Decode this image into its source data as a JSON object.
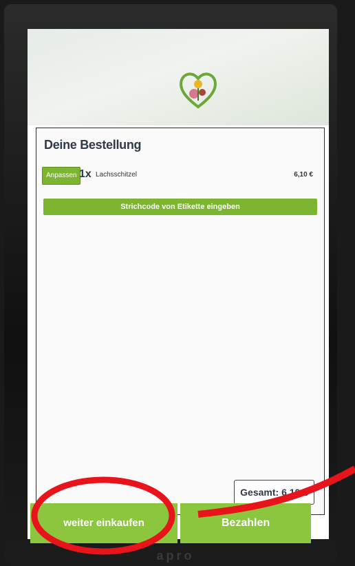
{
  "order": {
    "title": "Deine Bestellung",
    "items": [
      {
        "adjust_label": "Anpassen",
        "quantity": "1x",
        "name": "Lachsschitzel",
        "price": "6,10 €"
      }
    ],
    "barcode_label": "Strichcode von Etikette eingeben",
    "total_label": "Gesamt: 6,10 €"
  },
  "actions": {
    "continue_label": "weiter einkaufen",
    "pay_label": "Bezahlen"
  },
  "device": {
    "brand": "apro"
  },
  "colors": {
    "accent": "#8cc63f",
    "title_text": "#2d3a4a",
    "annotation": "#e8141b"
  },
  "icons": [
    "shop-logo-icon"
  ]
}
